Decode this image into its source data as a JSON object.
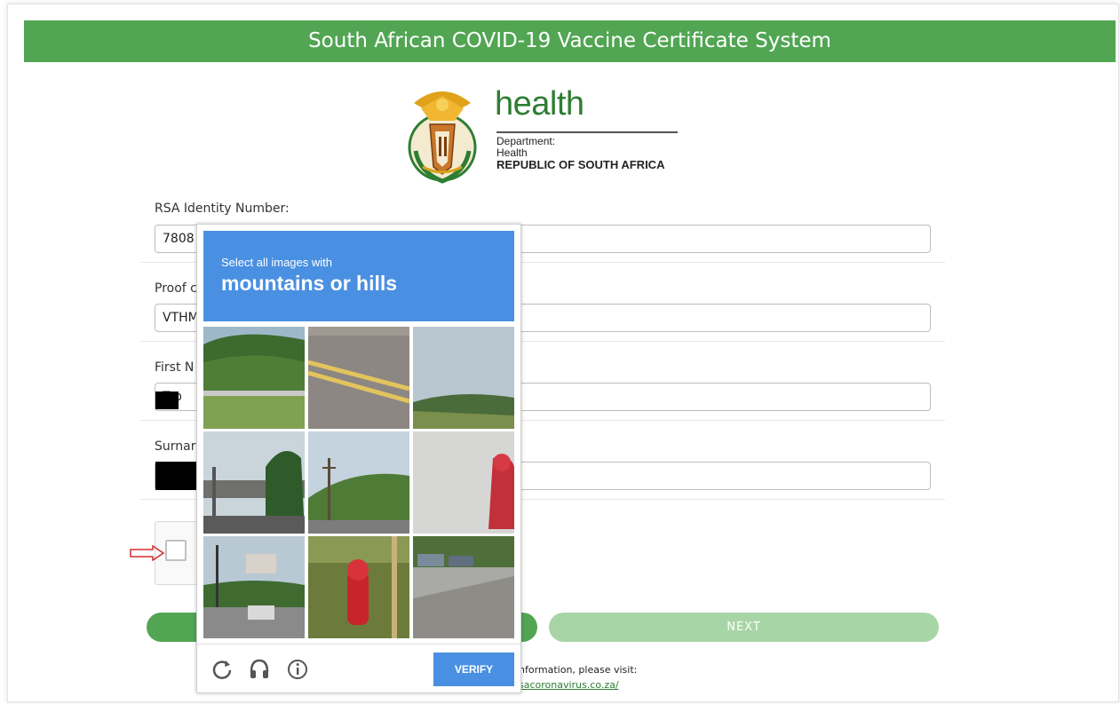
{
  "header": {
    "title": "South African COVID-19 Vaccine Certificate System"
  },
  "logo": {
    "word": "health",
    "dept_line1": "Department:",
    "dept_line2": "Health",
    "dept_line3": "REPUBLIC OF SOUTH AFRICA"
  },
  "form": {
    "id_label": "RSA Identity Number:",
    "id_value": "7808",
    "proof_label": "Proof c",
    "proof_value": "VTHM",
    "firstname_label": "First N",
    "firstname_value": "T  p",
    "surname_label": "Surnar",
    "surname_value": ""
  },
  "buttons": {
    "next": "NEXT"
  },
  "info": {
    "text": "nformation, please visit:",
    "link": "sacoronavirus.co.za/"
  },
  "captcha": {
    "instruction_small": "Select all images with",
    "instruction_big": "mountains or hills",
    "verify_label": "VERIFY",
    "footer_icons": [
      "reload-icon",
      "audio-headphones-icon",
      "info-icon"
    ],
    "tiles": [
      "hillside-with-guardrail",
      "road-with-yellow-lines",
      "sky-over-hills",
      "overpass-with-palm-tree",
      "hills-with-power-poles",
      "fire-hydrant-closeup",
      "street-with-billboard",
      "red-fire-hydrant-on-grass",
      "sidewalk-with-parked-cars"
    ]
  },
  "colors": {
    "header_green": "#52a553",
    "next_green": "#a8d5a6",
    "captcha_blue": "#4a90e2"
  }
}
